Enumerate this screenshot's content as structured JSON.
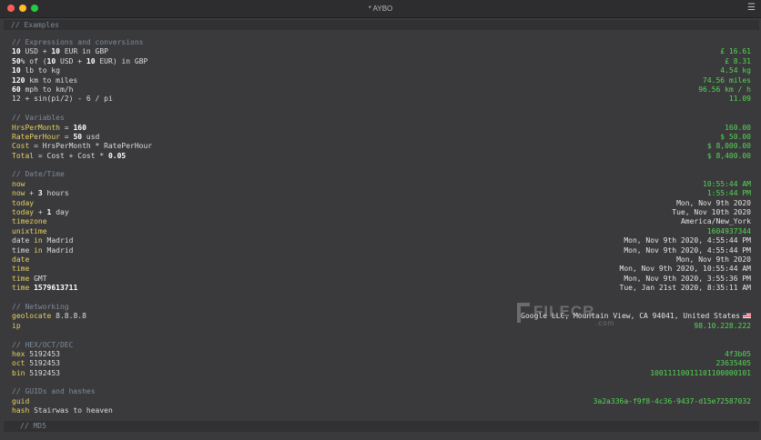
{
  "window": {
    "title": "* AYBO",
    "menu_icon": "hamburger-menu-icon"
  },
  "header_comment": "// Examples",
  "footer_comment": "// MD5",
  "sections": [
    {
      "comment": "// Expressions and conversions",
      "lines": [
        {
          "parts": [
            [
              "num",
              "10"
            ],
            [
              "op",
              " USD + "
            ],
            [
              "num",
              "10"
            ],
            [
              "op",
              " EUR in GBP"
            ]
          ],
          "result": "£ 16.61",
          "color": "green"
        },
        {
          "parts": [
            [
              "num",
              "50"
            ],
            [
              "op",
              "% of ("
            ],
            [
              "num",
              "10"
            ],
            [
              "op",
              " USD + "
            ],
            [
              "num",
              "10"
            ],
            [
              "op",
              " EUR) in GBP"
            ]
          ],
          "result": "£ 8.31",
          "color": "green"
        },
        {
          "parts": [
            [
              "num",
              "10"
            ],
            [
              "op",
              " lb to kg"
            ]
          ],
          "result": "4.54 kg",
          "color": "green"
        },
        {
          "parts": [
            [
              "num",
              "120"
            ],
            [
              "op",
              " km to miles"
            ]
          ],
          "result": "74.56 miles",
          "color": "green"
        },
        {
          "parts": [
            [
              "num",
              "60"
            ],
            [
              "op",
              " mph to km/h"
            ]
          ],
          "result": "96.56 km / h",
          "color": "green"
        },
        {
          "parts": [
            [
              "op",
              "12 + sin(pi/2) - 6 / pi"
            ]
          ],
          "result": "11.09",
          "color": "green"
        }
      ]
    },
    {
      "comment": "// Variables",
      "lines": [
        {
          "parts": [
            [
              "kw",
              "HrsPerMonth"
            ],
            [
              "op",
              " = "
            ],
            [
              "num",
              "160"
            ]
          ],
          "result": "160.00",
          "color": "green"
        },
        {
          "parts": [
            [
              "kw",
              "RatePerHour"
            ],
            [
              "op",
              " = "
            ],
            [
              "num",
              "50"
            ],
            [
              "op",
              " usd"
            ]
          ],
          "result": "$ 50.00",
          "color": "green"
        },
        {
          "parts": [
            [
              "kw",
              "Cost"
            ],
            [
              "op",
              " = HrsPerMonth * RatePerHour"
            ]
          ],
          "result": "$ 8,000.00",
          "color": "green"
        },
        {
          "parts": [
            [
              "kw",
              "Total"
            ],
            [
              "op",
              " = Cost + Cost * "
            ],
            [
              "num",
              "0.05"
            ]
          ],
          "result": "$ 8,400.00",
          "color": "green"
        }
      ]
    },
    {
      "comment": "// Date/Time",
      "lines": [
        {
          "parts": [
            [
              "kw",
              "now"
            ]
          ],
          "result": "10:55:44 AM",
          "color": "green"
        },
        {
          "parts": [
            [
              "kw",
              "now"
            ],
            [
              "op",
              " + "
            ],
            [
              "num",
              "3"
            ],
            [
              "op",
              " hours"
            ]
          ],
          "result": "1:55:44 PM",
          "color": "green"
        },
        {
          "parts": [
            [
              "kw",
              "today"
            ]
          ],
          "result": "Mon, Nov 9th 2020",
          "color": "white"
        },
        {
          "parts": [
            [
              "kw",
              "today"
            ],
            [
              "op",
              " + "
            ],
            [
              "num",
              "1"
            ],
            [
              "op",
              " day"
            ]
          ],
          "result": "Tue, Nov 10th 2020",
          "color": "white"
        },
        {
          "parts": [
            [
              "kw",
              "timezone"
            ]
          ],
          "result": "America/New_York",
          "color": "white"
        },
        {
          "parts": [
            [
              "kw",
              "unixtime"
            ]
          ],
          "result": "1604937344",
          "color": "green"
        },
        {
          "parts": [
            [
              "op",
              "date "
            ],
            [
              "kw",
              "in"
            ],
            [
              "op",
              " Madrid"
            ]
          ],
          "result": "Mon, Nov 9th 2020, 4:55:44 PM",
          "color": "white"
        },
        {
          "parts": [
            [
              "op",
              "time "
            ],
            [
              "kw",
              "in"
            ],
            [
              "op",
              " Madrid"
            ]
          ],
          "result": "Mon, Nov 9th 2020, 4:55:44 PM",
          "color": "white"
        },
        {
          "parts": [
            [
              "kw",
              "date"
            ]
          ],
          "result": "Mon, Nov 9th 2020",
          "color": "white"
        },
        {
          "parts": [
            [
              "kw",
              "time"
            ]
          ],
          "result": "Mon, Nov 9th 2020, 10:55:44 AM",
          "color": "white"
        },
        {
          "parts": [
            [
              "kw",
              "time"
            ],
            [
              "op",
              " GMT"
            ]
          ],
          "result": "Mon, Nov 9th 2020, 3:55:36 PM",
          "color": "white"
        },
        {
          "parts": [
            [
              "kw",
              "time"
            ],
            [
              "op",
              " "
            ],
            [
              "num",
              "1579613711"
            ]
          ],
          "result": "Tue, Jan 21st 2020, 8:35:11 AM",
          "color": "white"
        }
      ]
    },
    {
      "comment": "// Networking",
      "lines": [
        {
          "parts": [
            [
              "kw",
              "geolocate"
            ],
            [
              "op",
              " 8.8.8.8"
            ]
          ],
          "result": "Google LLC, Mountain View, CA 94041, United States",
          "color": "white",
          "flag": "us-flag-icon"
        },
        {
          "parts": [
            [
              "kw",
              "ip"
            ]
          ],
          "result": "98.10.228.222",
          "color": "green"
        }
      ]
    },
    {
      "comment": "// HEX/OCT/DEC",
      "lines": [
        {
          "parts": [
            [
              "kw",
              "hex"
            ],
            [
              "op",
              " 5192453"
            ]
          ],
          "result": "4f3b05",
          "color": "green"
        },
        {
          "parts": [
            [
              "kw",
              "oct"
            ],
            [
              "op",
              " 5192453"
            ]
          ],
          "result": "23635405",
          "color": "green"
        },
        {
          "parts": [
            [
              "kw",
              "bin"
            ],
            [
              "op",
              " 5192453"
            ]
          ],
          "result": "10011110011101100000101",
          "color": "green"
        }
      ]
    },
    {
      "comment": "// GUIDs and hashes",
      "lines": [
        {
          "parts": [
            [
              "kw",
              "guid"
            ]
          ],
          "result": "3a2a336a-f9f8-4c36-9437-d15e72587032",
          "color": "green"
        },
        {
          "parts": [
            [
              "kw",
              "hash"
            ],
            [
              "op",
              " Stairwas to heaven"
            ]
          ],
          "result": "",
          "color": "green"
        }
      ]
    }
  ],
  "watermark": {
    "text": "FILECR",
    "sub": ".com"
  }
}
